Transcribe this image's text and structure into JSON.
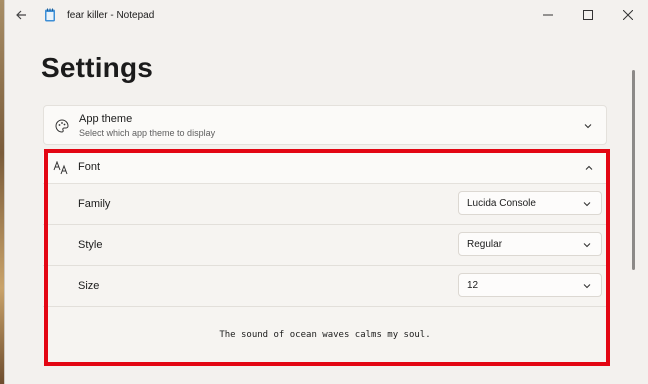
{
  "window": {
    "title": "fear killer - Notepad",
    "controls": [
      "minimize",
      "maximize",
      "close"
    ]
  },
  "page": {
    "title": "Settings"
  },
  "app_theme": {
    "title": "App theme",
    "subtitle": "Select which app theme to display",
    "icon": "palette-icon",
    "expanded": false
  },
  "font": {
    "title": "Font",
    "icon": "font-icon",
    "expanded": true,
    "family": {
      "label": "Family",
      "value": "Lucida Console"
    },
    "style": {
      "label": "Style",
      "value": "Regular"
    },
    "size": {
      "label": "Size",
      "value": "12"
    },
    "preview": "The sound of ocean waves calms my soul."
  },
  "colors": {
    "highlight": "#e30613",
    "window_bg": "#f3f1ee",
    "card_bg": "#fbfaf8"
  }
}
